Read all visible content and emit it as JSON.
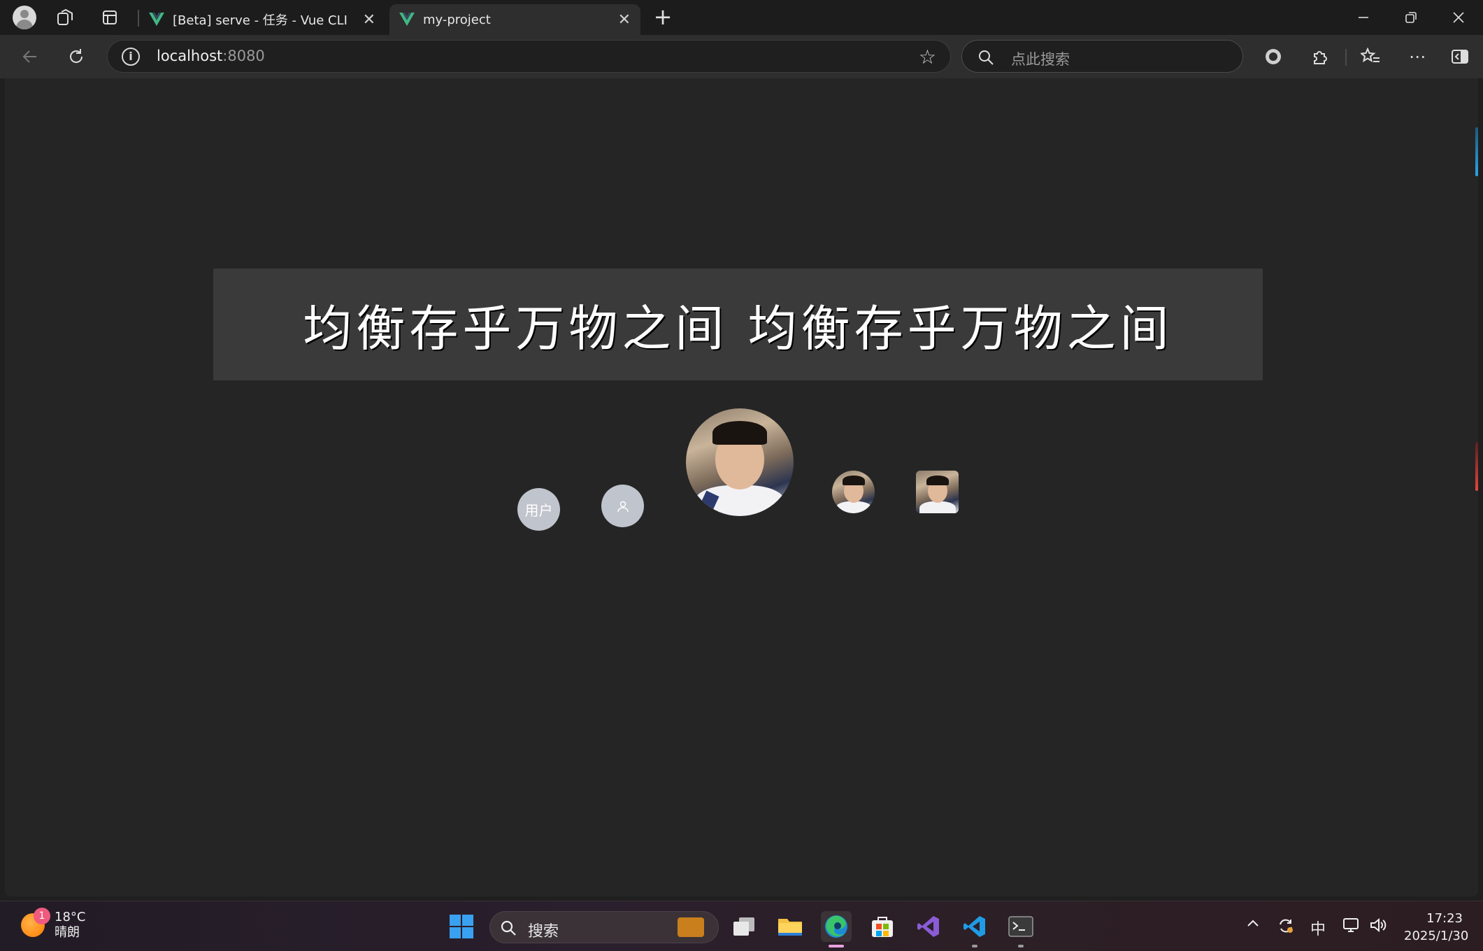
{
  "browser": {
    "tabs": [
      {
        "title": "[Beta] serve - 任务 - Vue CLI",
        "active": false
      },
      {
        "title": "my-project",
        "active": true
      }
    ],
    "address": {
      "host": "localhost",
      "port": ":8080"
    },
    "search_placeholder": "点此搜索"
  },
  "page": {
    "banner_text": "均衡存乎万物之间 均衡存乎万物之间",
    "avatars": [
      {
        "kind": "text",
        "label": "用户"
      },
      {
        "kind": "icon",
        "icon": "user-icon"
      },
      {
        "kind": "image",
        "shape": "circle",
        "size": "large"
      },
      {
        "kind": "image",
        "shape": "circle",
        "size": "small"
      },
      {
        "kind": "image",
        "shape": "square",
        "size": "small"
      }
    ]
  },
  "taskbar": {
    "weather": {
      "temp": "18°C",
      "condition": "晴朗",
      "badge": "1"
    },
    "search_label": "搜索",
    "apps": [
      "task-view-icon",
      "file-explorer-icon",
      "edge-icon",
      "store-icon",
      "visual-studio-icon",
      "vscode-icon",
      "terminal-icon"
    ],
    "tray": {
      "ime": "中"
    },
    "clock": {
      "time": "17:23",
      "date": "2025/1/30"
    }
  },
  "colors": {
    "vue_green": "#41b883",
    "accent_blue": "#2aa4e6",
    "scroll_red": "#e8453c"
  }
}
